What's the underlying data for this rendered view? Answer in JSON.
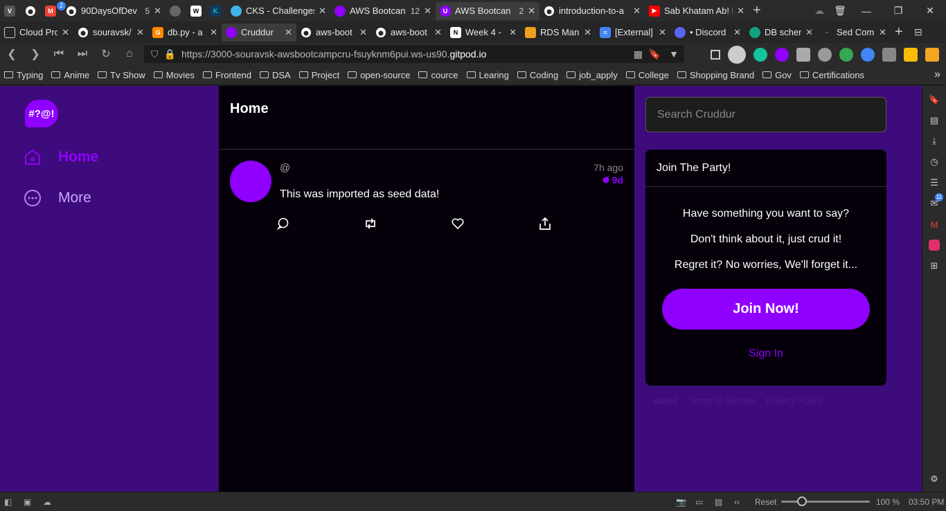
{
  "browser": {
    "tabs_row1": [
      {
        "icon": "github-icon",
        "title": "",
        "count": "",
        "color": "#ffffff"
      },
      {
        "icon": "gmail-icon",
        "title": "",
        "count": "2",
        "color": "#ea4335"
      },
      {
        "icon": "github-icon",
        "title": "90DaysOfDev",
        "count": "5",
        "color": "#ffffff"
      },
      {
        "icon": "globe-icon",
        "title": "",
        "count": "",
        "color": "#888888"
      },
      {
        "icon": "wiki-icon",
        "title": "",
        "count": "",
        "color": "#ffffff"
      },
      {
        "icon": "app-icon",
        "title": "",
        "count": "",
        "color": "#20c997"
      },
      {
        "icon": "cloud-icon",
        "title": "CKS - Challenges",
        "count": "",
        "color": "#3fb4e8"
      },
      {
        "icon": "cruddur-icon",
        "title": "AWS Bootcan",
        "count": "12",
        "color": "#8f00ff"
      },
      {
        "icon": "u-icon",
        "title": "AWS Bootcan",
        "count": "2",
        "color": "#8f00ff"
      },
      {
        "icon": "github-icon",
        "title": "introduction-to-a",
        "count": "",
        "color": "#ffffff"
      },
      {
        "icon": "youtube-icon",
        "title": "Sab Khatam Ab! N",
        "count": "",
        "color": "#ff0000"
      }
    ],
    "tabs_row2": [
      {
        "icon": "page-icon",
        "title": "Cloud Pro",
        "color": "#cccccc"
      },
      {
        "icon": "github-icon",
        "title": "souravsk/",
        "color": "#ffffff"
      },
      {
        "icon": "gitpod-icon",
        "title": "db.py - a",
        "color": "#ff8a00"
      },
      {
        "icon": "cruddur-icon",
        "title": "Cruddur",
        "color": "#8f00ff"
      },
      {
        "icon": "github-icon",
        "title": "aws-boot",
        "color": "#ffffff"
      },
      {
        "icon": "github-icon",
        "title": "aws-boot",
        "color": "#ffffff"
      },
      {
        "icon": "notion-icon",
        "title": "Week 4 -",
        "color": "#ffffff"
      },
      {
        "icon": "aws-icon",
        "title": "RDS Man",
        "color": "#f0a020"
      },
      {
        "icon": "docs-icon",
        "title": "[External]",
        "color": "#4285f4"
      },
      {
        "icon": "discord-icon",
        "title": "• Discord",
        "color": "#5865f2"
      },
      {
        "icon": "chatgpt-icon",
        "title": "DB schem",
        "color": "#10a37f"
      },
      {
        "icon": "sed-icon",
        "title": "Sed Com",
        "color": "#3fa34d"
      }
    ],
    "url_prefix": "https://3000-souravsk-awsbootcampcru-fsuyknm6pui.ws-us90.",
    "url_domain": "gitpod.io",
    "bookmarks": [
      "Typing",
      "Anime",
      "Tv Show",
      "Movies",
      "Frontend",
      "DSA",
      "Project",
      "open-source",
      "cource",
      "Learing",
      "Coding",
      "job_apply",
      "College",
      "Shopping Brand",
      "Gov",
      "Certifications"
    ],
    "status": {
      "reset_label": "Reset",
      "zoom": "100 %",
      "time": "03:50 PM",
      "zoom_level": 0.5
    },
    "side_badge": "11"
  },
  "app": {
    "brand_color": "#8f00ff",
    "logo_text": "#?@!",
    "nav": [
      {
        "label": "Home",
        "icon": "home-icon",
        "active": true
      },
      {
        "label": "More",
        "icon": "more-icon",
        "active": false
      }
    ],
    "feed_title": "Home",
    "activities": [
      {
        "handle": "@",
        "time_ago": "7h ago",
        "expires": "9d",
        "message": "This was imported as seed data!"
      }
    ],
    "search_placeholder": "Search Cruddur",
    "party": {
      "title": "Join The Party!",
      "lines": [
        "Have something you want to say?",
        "Don't think about it, just crud it!",
        "Regret it? No worries, We'll forget it..."
      ],
      "join_label": "Join Now!",
      "signin_label": "Sign In"
    },
    "footer_links": [
      "About",
      "Terms of Service",
      "Privacy Policy"
    ]
  }
}
